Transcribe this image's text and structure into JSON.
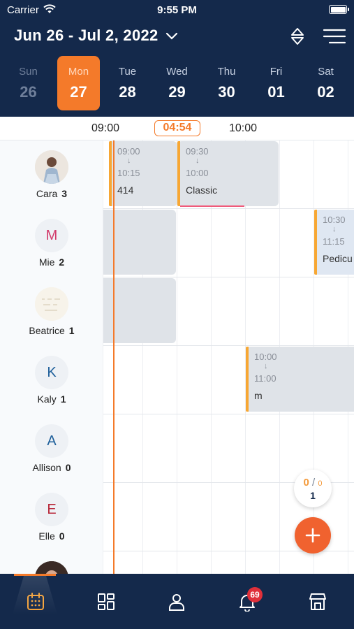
{
  "status_bar": {
    "carrier": "Carrier",
    "time": "9:55 PM"
  },
  "header": {
    "date_range": "Jun 26 - Jul 2, 2022"
  },
  "week": [
    {
      "name": "Sun",
      "num": "26",
      "state": "past"
    },
    {
      "name": "Mon",
      "num": "27",
      "state": "selected"
    },
    {
      "name": "Tue",
      "num": "28",
      "state": "normal"
    },
    {
      "name": "Wed",
      "num": "29",
      "state": "normal"
    },
    {
      "name": "Thu",
      "num": "30",
      "state": "normal"
    },
    {
      "name": "Fri",
      "num": "01",
      "state": "normal"
    },
    {
      "name": "Sat",
      "num": "02",
      "state": "normal"
    }
  ],
  "timeline": {
    "labels": [
      "09:00",
      "10:00"
    ],
    "now": "04:54"
  },
  "staff": [
    {
      "name": "Cara",
      "count": "3",
      "initial": "",
      "avatar": "photo"
    },
    {
      "name": "Mie",
      "count": "2",
      "initial": "M",
      "color": "#d23a6a"
    },
    {
      "name": "Beatrice",
      "count": "1",
      "initial": "",
      "avatar": "blank-photo"
    },
    {
      "name": "Kaly",
      "count": "1",
      "initial": "K",
      "color": "#1e5f9a"
    },
    {
      "name": "Allison",
      "count": "0",
      "initial": "A",
      "color": "#1e5f9a"
    },
    {
      "name": "Elle",
      "count": "0",
      "initial": "E",
      "color": "#b8283a"
    }
  ],
  "appointments": [
    {
      "start": "09:00",
      "end": "10:15",
      "service": "414"
    },
    {
      "start": "09:30",
      "end": "10:00",
      "service": "Classic"
    },
    {
      "start": "10:30",
      "end": "11:15",
      "service": "Pedicu"
    },
    {
      "start": "10:00",
      "end": "11:00",
      "service": "m"
    }
  ],
  "counter": {
    "done": "0",
    "separator": "/",
    "total": "0",
    "count": "1"
  },
  "fab": {
    "label": "+"
  },
  "bottom_nav": {
    "notification_count": "69"
  },
  "colors": {
    "header_bg": "#14294b",
    "accent": "#f47a2a",
    "fab": "#f0622f",
    "badge": "#e0303a"
  }
}
